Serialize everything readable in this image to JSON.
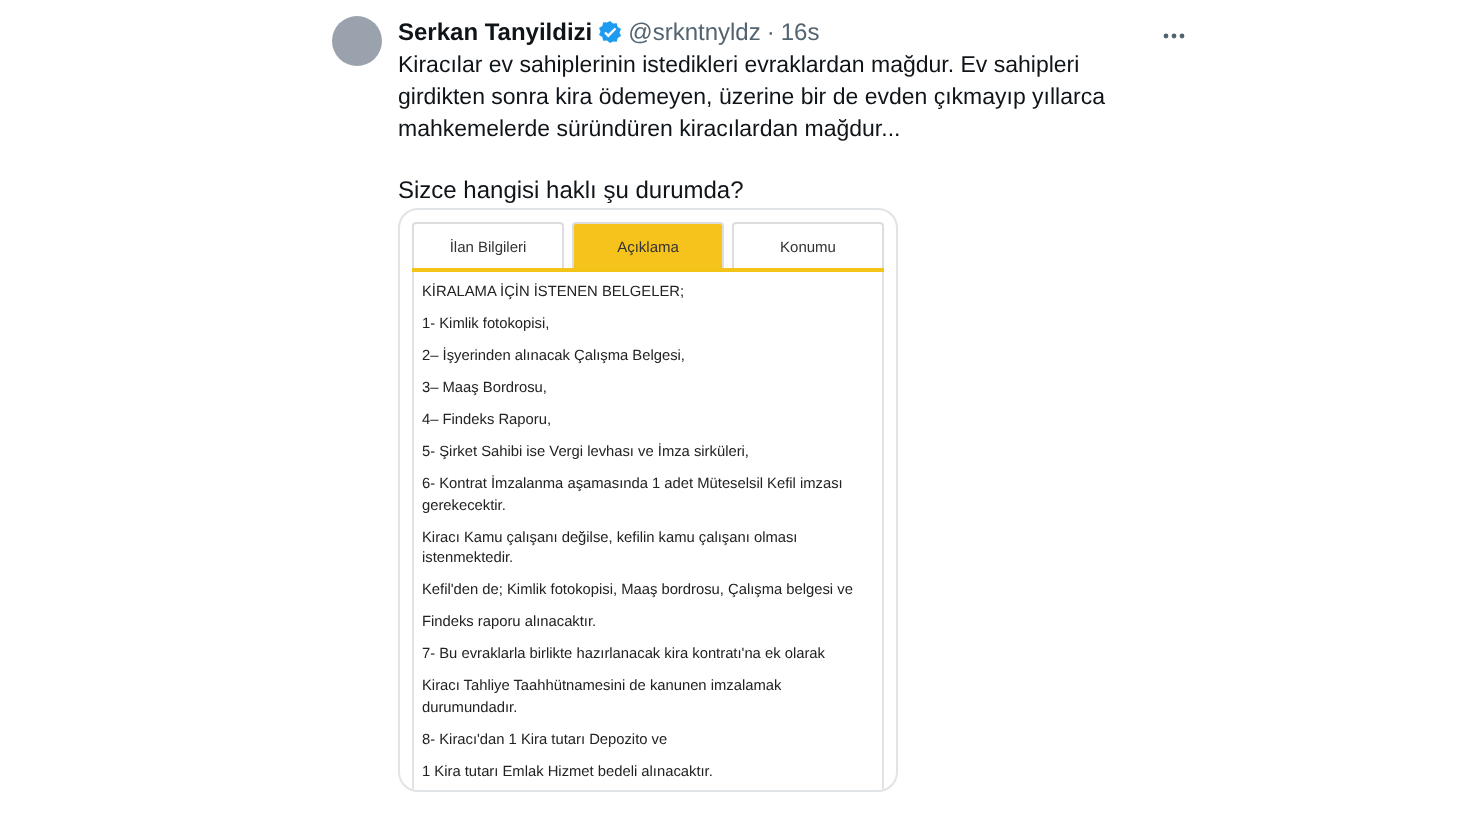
{
  "tweet": {
    "author": "Serkan Tanyildizi",
    "verified": true,
    "handle": "@srkntnyldz",
    "separator": "·",
    "time": "16s",
    "text": [
      "Kiracılar ev sahiplerinin istedikleri evraklardan mağdur. Ev sahipleri",
      "girdikten sonra kira ödemeyen, üzerine bir de evden çıkmayıp yıllarca",
      "mahkemelerde süründüren kiracılardan mağdur..."
    ],
    "question": "Sizce hangisi haklı şu durumda?"
  },
  "listing": {
    "tabs": [
      {
        "label": "İlan Bilgileri",
        "selected": false
      },
      {
        "label": "Açıklama",
        "selected": true
      },
      {
        "label": "Konumu",
        "selected": false
      }
    ],
    "paragraphs": [
      {
        "lines": [
          "KİRALAMA İÇİN İSTENEN BELGELER;"
        ]
      },
      {
        "lines": [
          "1- Kimlik fotokopisi,"
        ]
      },
      {
        "lines": [
          "2– İşyerinden alınacak Çalışma Belgesi,"
        ]
      },
      {
        "lines": [
          "3– Maaş Bordrosu,"
        ]
      },
      {
        "lines": [
          "4– Findeks Raporu,"
        ]
      },
      {
        "lines": [
          "5- Şirket Sahibi ise Vergi levhası ve İmza sirküleri,"
        ]
      },
      {
        "lines": [
          "6- Kontrat İmzalanma aşamasında 1 adet Müteselsil Kefil imzası",
          "gerekecektir."
        ]
      },
      {
        "lines": [
          "Kiracı Kamu çalışanı değilse, kefilin kamu çalışanı olması",
          "istenmektedir."
        ]
      },
      {
        "lines": [
          "Kefil'den de; Kimlik fotokopisi, Maaş bordrosu, Çalışma belgesi ve"
        ]
      },
      {
        "lines": [
          "Findeks raporu alınacaktır."
        ]
      },
      {
        "lines": [
          "7- Bu evraklarla birlikte hazırlanacak kira kontratı'na ek olarak"
        ]
      },
      {
        "lines": [
          "Kiracı Tahliye Taahhütnamesini de kanunen imzalamak",
          "durumundadır."
        ]
      },
      {
        "lines": [
          "8- Kiracı'dan 1 Kira tutarı Depozito ve"
        ]
      },
      {
        "lines": [
          "1 Kira tutarı Emlak Hizmet bedeli alınacaktır."
        ]
      }
    ]
  }
}
